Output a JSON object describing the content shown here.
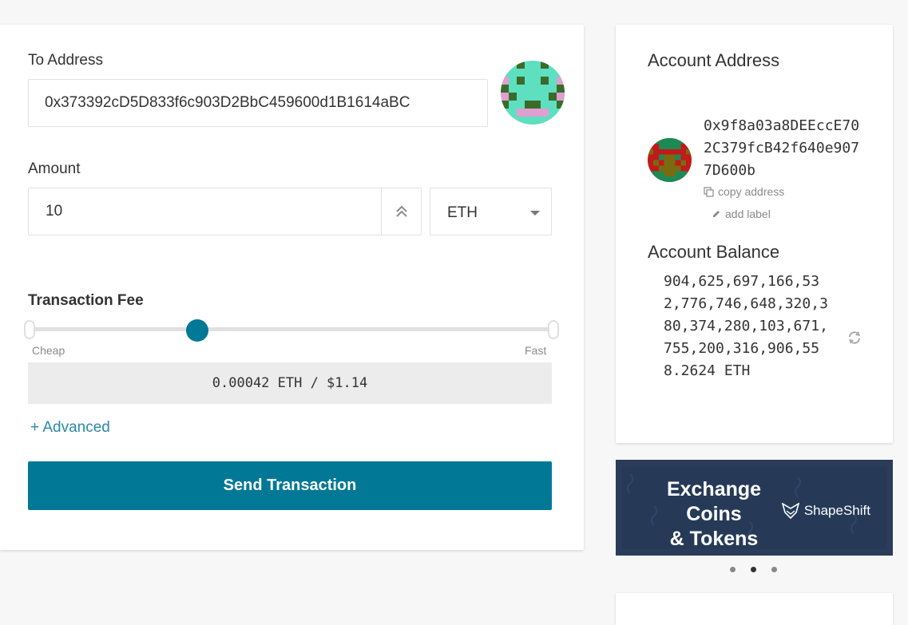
{
  "send": {
    "to_label": "To Address",
    "to_value": "0x373392cD5D833f6c903D2BbC459600d1B1614aBC",
    "amount_label": "Amount",
    "amount_value": "10",
    "unit_value": "ETH",
    "fee_label": "Transaction Fee",
    "fee_slider_level": 0.32,
    "fee_cheap": "Cheap",
    "fee_fast": "Fast",
    "fee_display": "0.00042 ETH / $1.14",
    "advanced_link": "+ Advanced",
    "send_button": "Send Transaction"
  },
  "account": {
    "address_title": "Account Address",
    "address": "0x9f8a03a8DEEccE702C379fcB42f640e9077D600b",
    "copy_address": "copy address",
    "add_label": "add label",
    "balance_title": "Account Balance",
    "balance": "904,625,697,166,532,776,746,648,320,380,374,280,103,671,755,200,316,906,558.2624 ETH"
  },
  "banner": {
    "title": "Exchange Coins & Tokens",
    "logo_text": "ShapeShift"
  },
  "carousel": {
    "count": 3,
    "active": 1
  },
  "colors": {
    "primary": "#007896",
    "link": "#2a89a8",
    "banner_bg": "#263a58"
  },
  "icons": {
    "max": "double-chevron-up-icon",
    "caret": "caret-down-icon",
    "copy": "copy-icon",
    "edit": "pencil-icon",
    "refresh": "refresh-icon",
    "fox": "shapeshift-fox-icon"
  }
}
